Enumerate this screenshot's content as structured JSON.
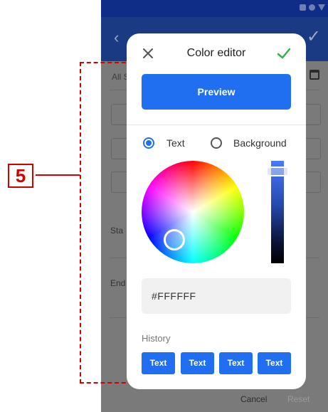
{
  "background": {
    "all_label": "All S",
    "start_label": "Sta",
    "end_label": "End",
    "cancel_label": "Cancel",
    "reset_label": "Reset"
  },
  "callout": {
    "number": "5"
  },
  "dialog": {
    "title": "Color editor",
    "close_icon": "close-icon",
    "confirm_icon": "check-icon",
    "preview_label": "Preview",
    "target_options": [
      {
        "label": "Text",
        "selected": true
      },
      {
        "label": "Background",
        "selected": false
      }
    ],
    "hex_value": "#FFFFFF",
    "history_label": "History",
    "history": [
      {
        "label": "Text"
      },
      {
        "label": "Text"
      },
      {
        "label": "Text"
      },
      {
        "label": "Text"
      }
    ]
  },
  "colors": {
    "accent": "#1f6ff0",
    "confirm": "#2bb64b",
    "callout": "#d40000",
    "appbar": "#1a3b84",
    "statusbar": "#0f2d86"
  }
}
